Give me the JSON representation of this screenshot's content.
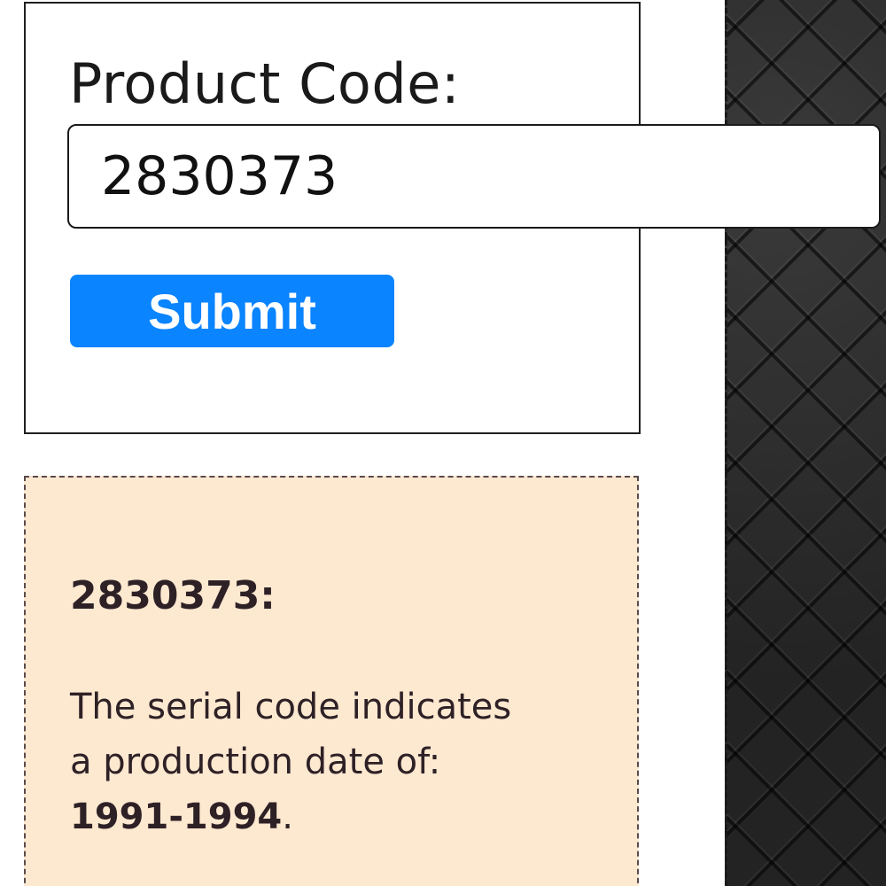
{
  "form": {
    "label": "Product Code:",
    "input_value": "2830373",
    "submit_label": "Submit"
  },
  "result": {
    "code_heading": "2830373:",
    "description_line1": "The serial code indicates",
    "description_line2": "a production date of:",
    "date_range": "1991-1994",
    "trailing_punct": "."
  },
  "colors": {
    "submit_button": "#0a84ff",
    "result_background": "#fde8d0",
    "quilt_panel": "#2b2b2b"
  }
}
